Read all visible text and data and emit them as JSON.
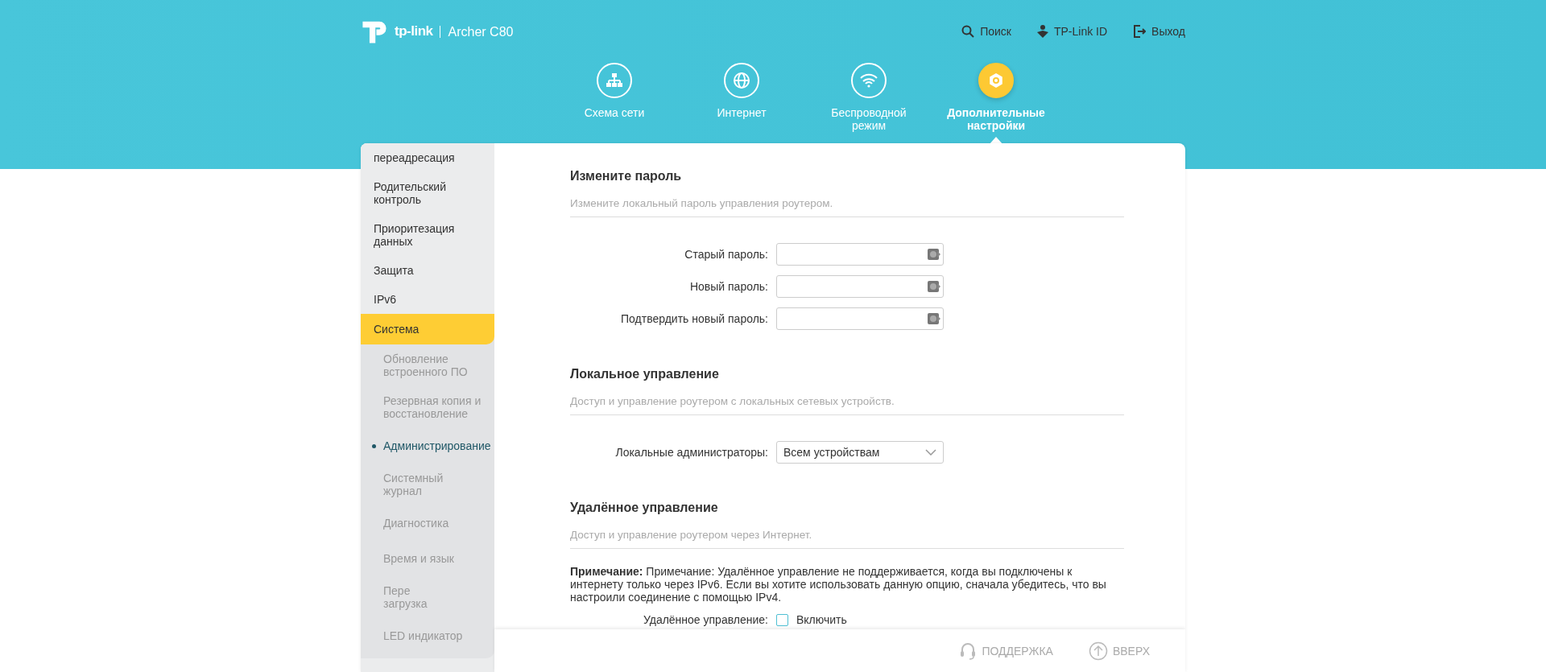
{
  "header": {
    "brand": "tp-link",
    "model": "Archer C80",
    "links": [
      {
        "kind": "search",
        "label": "Поиск"
      },
      {
        "kind": "id",
        "label": "TP-Link ID"
      },
      {
        "kind": "logout",
        "label": "Выход"
      }
    ]
  },
  "nav": [
    {
      "kind": "network",
      "label": "Схема сети",
      "selected": false
    },
    {
      "kind": "globe",
      "label": "Интернет",
      "selected": false
    },
    {
      "kind": "wifi",
      "label": "Беспроводной режим",
      "selected": false
    },
    {
      "kind": "gear",
      "label": "Дополнительные настройки",
      "selected": true
    }
  ],
  "sidebar": {
    "items": [
      {
        "label": "переадресация",
        "selected": false
      },
      {
        "label": "Родительский контроль",
        "selected": false
      },
      {
        "label": "Приоритезация данных",
        "selected": false
      },
      {
        "label": "Защита",
        "selected": false
      },
      {
        "label": "IPv6",
        "selected": false
      },
      {
        "label": "Система",
        "selected": true,
        "children": [
          {
            "label": "Обновление встроенного ПО",
            "selected": false
          },
          {
            "label": "Резервная копия и восстановление",
            "selected": false
          },
          {
            "label": "Администрирование",
            "selected": true
          },
          {
            "label": "Системный\nжурнал",
            "selected": false
          },
          {
            "label": "Диагностика",
            "selected": false
          },
          {
            "label": "Время и язык",
            "selected": false
          },
          {
            "label": "Пере\nзагрузка",
            "selected": false
          },
          {
            "label": "LED индикатор",
            "selected": false
          }
        ]
      }
    ]
  },
  "sections": [
    {
      "title": "Измените пароль",
      "subtitle": "Измените локальный пароль управления роутером.",
      "fields": [
        {
          "kind": "password",
          "label": "Старый пароль:"
        },
        {
          "kind": "password",
          "label": "Новый пароль:"
        },
        {
          "kind": "password",
          "label": "Подтвердить новый пароль:"
        }
      ]
    },
    {
      "title": "Локальное управление",
      "subtitle": "Доступ и управление роутером с локальных сетевых устройств.",
      "fields": [
        {
          "kind": "select",
          "label": "Локальные администраторы:",
          "value": "Всем устройствам"
        }
      ]
    },
    {
      "title": "Удалённое управление",
      "subtitle": "Доступ и управление роутером через Интернет.",
      "note": "**Примечание:** Примечание: Удалённое управление не поддерживается, когда вы подключены к интернету только через IPv6. Если вы хотите использовать данную опцию, сначала убедитесь, что вы настроили соединение с помощью IPv4.",
      "fields": [
        {
          "kind": "checkbox",
          "label": "Удалённое управление:",
          "option": "Включить",
          "checked": false
        }
      ]
    }
  ],
  "footer": [
    {
      "kind": "support",
      "label": "ПОДДЕРЖКА"
    },
    {
      "kind": "top",
      "label": "ВВЕРХ"
    }
  ]
}
